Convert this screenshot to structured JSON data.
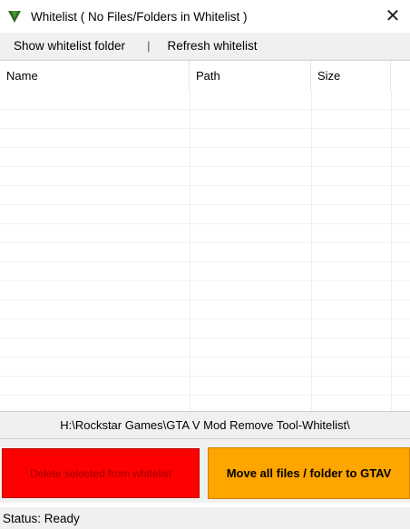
{
  "window": {
    "title": "Whitelist ( No Files/Folders in Whitelist )",
    "close_label": "✕",
    "icon": "gta-v-icon",
    "icon_color": "#2e6b1e"
  },
  "menu": {
    "items": [
      {
        "label": "Show whitelist folder"
      },
      {
        "label": "Refresh whitelist"
      }
    ],
    "separator": "|"
  },
  "table": {
    "columns": [
      "Name",
      "Path",
      "Size"
    ],
    "rows": []
  },
  "path_display": "H:\\Rockstar Games\\GTA V Mod Remove Tool-Whitelist\\",
  "buttons": {
    "delete_label": "Delete selected from whitelist",
    "delete_color": "#ff0000",
    "move_label": "Move all files / folder to GTAV",
    "move_color": "#ffa500"
  },
  "status": {
    "text": "Status: Ready"
  }
}
